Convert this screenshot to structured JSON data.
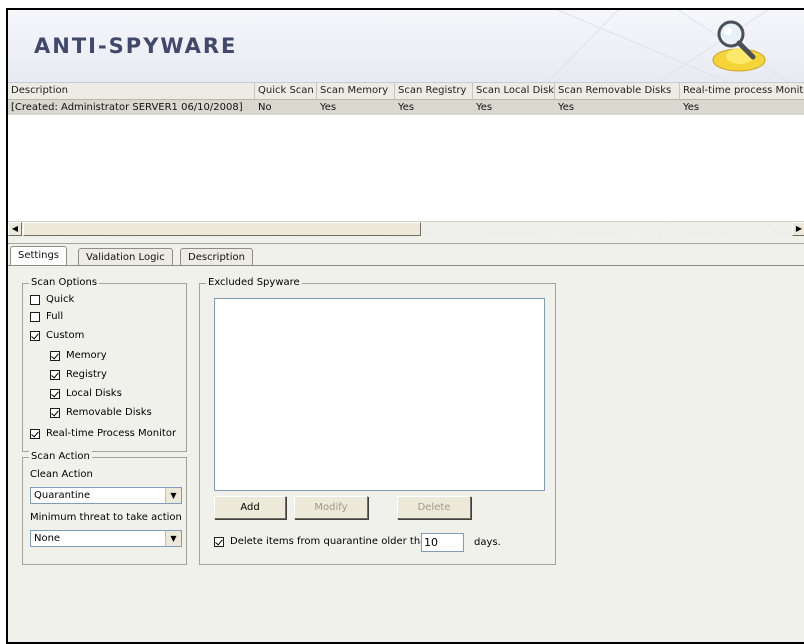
{
  "header": {
    "title": "ANTI-SPYWARE",
    "logo_icon": "magnifier-icon"
  },
  "grid": {
    "columns": [
      "Description",
      "Quick Scan",
      "Scan Memory",
      "Scan Registry",
      "Scan Local Disks",
      "Scan Removable Disks",
      "Real-time process Monit"
    ],
    "rows": [
      [
        "[Created: Administrator SERVER1 06/10/2008]",
        "No",
        "Yes",
        "Yes",
        "Yes",
        "Yes",
        "Yes"
      ]
    ],
    "scroll_left_icon": "arrow-left-icon",
    "scroll_right_icon": "arrow-right-icon"
  },
  "tabs": [
    {
      "label": "Settings",
      "active": true
    },
    {
      "label": "Validation Logic",
      "active": false
    },
    {
      "label": "Description",
      "active": false
    }
  ],
  "scan_options": {
    "title": "Scan Options",
    "quick": {
      "label": "Quick",
      "checked": false
    },
    "full": {
      "label": "Full",
      "checked": false
    },
    "custom": {
      "label": "Custom",
      "checked": true
    },
    "memory": {
      "label": "Memory",
      "checked": true
    },
    "registry": {
      "label": "Registry",
      "checked": true
    },
    "local_disks": {
      "label": "Local Disks",
      "checked": true
    },
    "removable_disks": {
      "label": "Removable Disks",
      "checked": true
    },
    "realtime": {
      "label": "Real-time Process Monitor",
      "checked": true
    }
  },
  "scan_action": {
    "title": "Scan Action",
    "clean_action_label": "Clean Action",
    "clean_action_value": "Quarantine",
    "min_threat_label": "Minimum threat to take action",
    "min_threat_value": "None"
  },
  "excluded": {
    "title": "Excluded Spyware",
    "add_label": "Add",
    "modify_label": "Modify",
    "delete_label": "Delete",
    "quarantine_label": "Delete items from quarantine older than",
    "quarantine_checked": true,
    "days_value": "10",
    "days_label": "days."
  }
}
